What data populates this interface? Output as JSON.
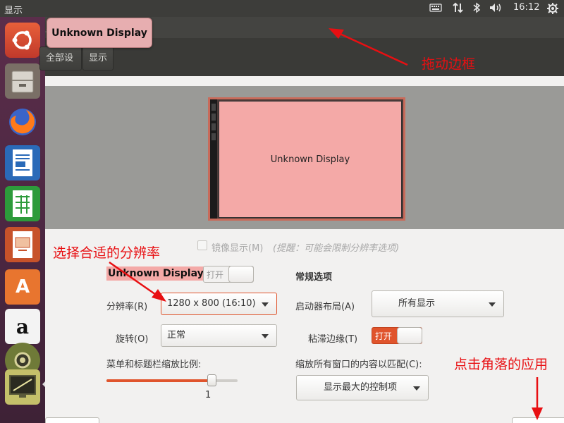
{
  "topbar": {
    "title": "显示",
    "keyboard_icon": "keyboard-icon",
    "network_icon": "network-icon",
    "bluetooth_icon": "bluetooth-icon",
    "volume_icon": "volume-icon",
    "time": "16:12",
    "power_icon": "gear-icon"
  },
  "launcher": {
    "items": [
      {
        "icon": "ubuntu-logo-icon",
        "color": "#dd4814"
      },
      {
        "icon": "files-icon",
        "color": "#cfcbc0"
      },
      {
        "icon": "firefox-icon",
        "color": "#ff7a1a"
      },
      {
        "icon": "writer-icon",
        "color": "#2a6ab8"
      },
      {
        "icon": "calc-icon",
        "color": "#2d9b3b"
      },
      {
        "icon": "impress-icon",
        "color": "#c7522a"
      },
      {
        "icon": "software-center-icon",
        "color": "#e8752f"
      },
      {
        "icon": "amazon-icon",
        "color": "#f3f3f3"
      },
      {
        "icon": "system-settings-icon",
        "color": "#7a8a3a"
      },
      {
        "icon": "display-settings-icon",
        "color": "#c4c06a"
      }
    ]
  },
  "window": {
    "ghost_title": "显示",
    "drag_label": "Unknown Display",
    "toolbar": {
      "all_settings": "全部设置(A)",
      "display": "显示"
    }
  },
  "preview": {
    "monitor_label": "Unknown Display"
  },
  "settings": {
    "mirror_label": "镜像显示(M)",
    "mirror_hint": "(提醒：可能会限制分辨率选项)",
    "display_name": "Unknown Display",
    "display_toggle": "打开",
    "resolution_label": "分辨率(R)",
    "resolution_value": "1280 x 800 (16:10)",
    "rotation_label": "旋转(O)",
    "rotation_value": "正常",
    "scale_label": "菜单和标题栏缩放比例:",
    "scale_value": "1",
    "scale_fraction": 0.8,
    "general_header": "常规选项",
    "launcher_label": "启动器布局(A)",
    "launcher_value": "所有显示",
    "sticky_label": "粘滞边缘(T)",
    "sticky_toggle": "打开",
    "fit_label": "缩放所有窗口的内容以匹配(C):",
    "fit_value": "显示最大的控制项"
  },
  "annotations": {
    "drag_border": "拖动边框",
    "choose_resolution": "选择合适的分辨率",
    "click_corner_apply": "点击角落的应用",
    "color": "#e80f12"
  }
}
